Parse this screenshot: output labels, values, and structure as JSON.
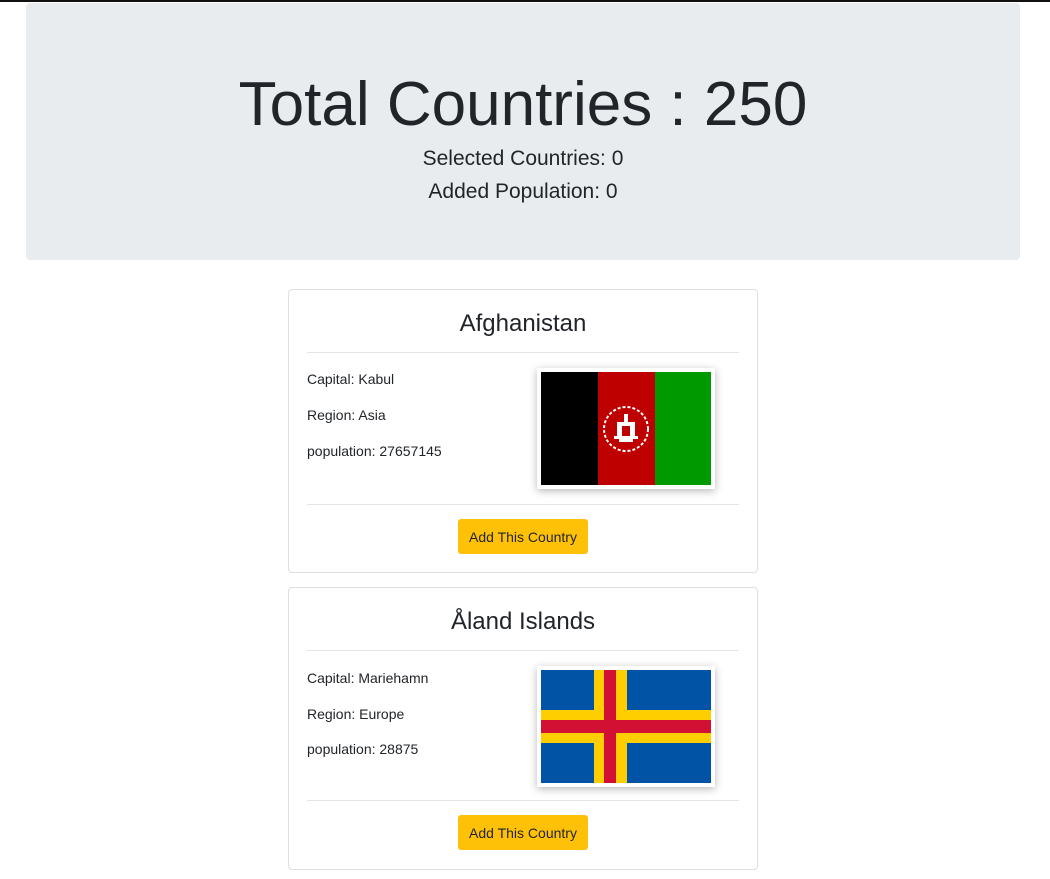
{
  "header": {
    "title": "Total Countries : 250",
    "selected": "Selected Countries: 0",
    "population": "Added Population: 0"
  },
  "countries": [
    {
      "name": "Afghanistan",
      "capital": "Capital: Kabul",
      "region": "Region: Asia",
      "population": "population: 27657145",
      "button_label": "Add This Country",
      "flag_colors": [
        "#000000",
        "#be0000",
        "#009900"
      ]
    },
    {
      "name": "Åland Islands",
      "capital": "Capital: Mariehamn",
      "region": "Region: Europe",
      "population": "population: 28875",
      "button_label": "Add This Country",
      "flag_colors": [
        "#0053a5",
        "#ffce00",
        "#d21034"
      ]
    }
  ],
  "colors": {
    "jumbotron_bg": "#e9ecef",
    "button_bg": "#ffc107"
  }
}
